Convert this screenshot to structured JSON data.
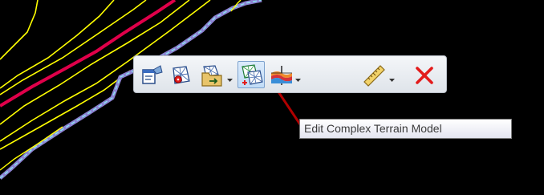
{
  "toolbar": {
    "buttons": [
      {
        "icon": "terrain-model-properties-icon"
      },
      {
        "icon": "create-terrain-from-graphics-icon"
      },
      {
        "icon": "import-terrain-icon",
        "dropdown": true
      },
      {
        "icon": "edit-complex-terrain-model-icon",
        "active": true
      },
      {
        "icon": "terrain-profile-icon",
        "dropdown": true
      },
      {
        "icon": "measure-ruler-icon",
        "dropdown": true
      },
      {
        "icon": "close-icon"
      }
    ]
  },
  "tooltip": {
    "text": "Edit Complex Terrain Model"
  },
  "colors": {
    "background": "#000000",
    "contour_yellow": "#ffff00",
    "highlight_red": "#e0004a",
    "boundary_blue": "#8c82d2",
    "boundary_cyan": "#8ae8f0",
    "pointer_red": "#b00000",
    "toolbar_bg": "#e6eaef",
    "active_bg": "#c8def6",
    "close_red": "#e31b1b"
  }
}
